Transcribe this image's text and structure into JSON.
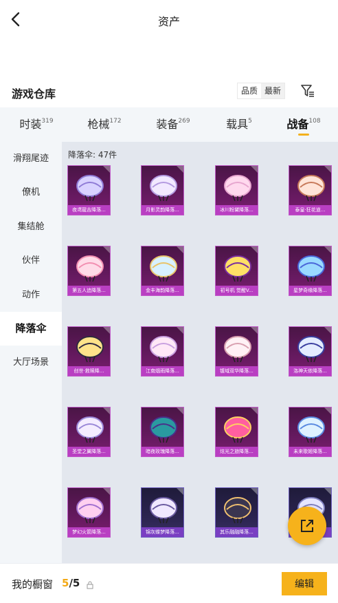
{
  "header": {
    "title": "资产"
  },
  "warehouse": {
    "title": "游戏仓库",
    "sort_quality": "品质",
    "sort_latest": "最新"
  },
  "tabs": [
    {
      "label": "时装",
      "count": "319"
    },
    {
      "label": "枪械",
      "count": "172"
    },
    {
      "label": "装备",
      "count": "269"
    },
    {
      "label": "载具",
      "count": "5"
    },
    {
      "label": "战备",
      "count": "108"
    }
  ],
  "sidebar": [
    {
      "label": "滑翔尾迹"
    },
    {
      "label": "僚机"
    },
    {
      "label": "集结舱"
    },
    {
      "label": "伙伴"
    },
    {
      "label": "动作"
    },
    {
      "label": "降落伞"
    },
    {
      "label": "大厅场景"
    }
  ],
  "content": {
    "count_label": "降落伞: 47件",
    "items": [
      {
        "name": "夜鸢龍吉降落..."
      },
      {
        "name": "月影灵韵降落..."
      },
      {
        "name": "冰川粉黛降落..."
      },
      {
        "name": "泰皇·狂花道..."
      },
      {
        "name": "第五人追降落..."
      },
      {
        "name": "金丰海韵降落..."
      },
      {
        "name": "初号机 觉醒V..."
      },
      {
        "name": "星梦奇缘降落..."
      },
      {
        "name": "创世·救赎降..."
      },
      {
        "name": "江南烟雨降落..."
      },
      {
        "name": "镀域双华降落..."
      },
      {
        "name": "洛神天依降落..."
      },
      {
        "name": "圣堂之翼降落..."
      },
      {
        "name": "暗夜玫瑰降落..."
      },
      {
        "name": "炫光之旅降落..."
      },
      {
        "name": "未来歌姬降落..."
      },
      {
        "name": "梦幻火箭降落..."
      },
      {
        "name": "锦灰蝶梦降落..."
      },
      {
        "name": "其乐融融降落..."
      },
      {
        "name": ""
      }
    ]
  },
  "bottom": {
    "showcase_label": "我的橱窗",
    "showcase_used": "5",
    "showcase_sep_total": "/5",
    "edit_label": "编辑"
  },
  "icons": {
    "back": "back-arrow-icon",
    "filter": "filter-icon",
    "share": "share-icon",
    "lock": "lock-icon"
  },
  "colors": {
    "accent": "#f6b21b",
    "card_purple": "#63195d",
    "card_label": "#b93fc2"
  }
}
